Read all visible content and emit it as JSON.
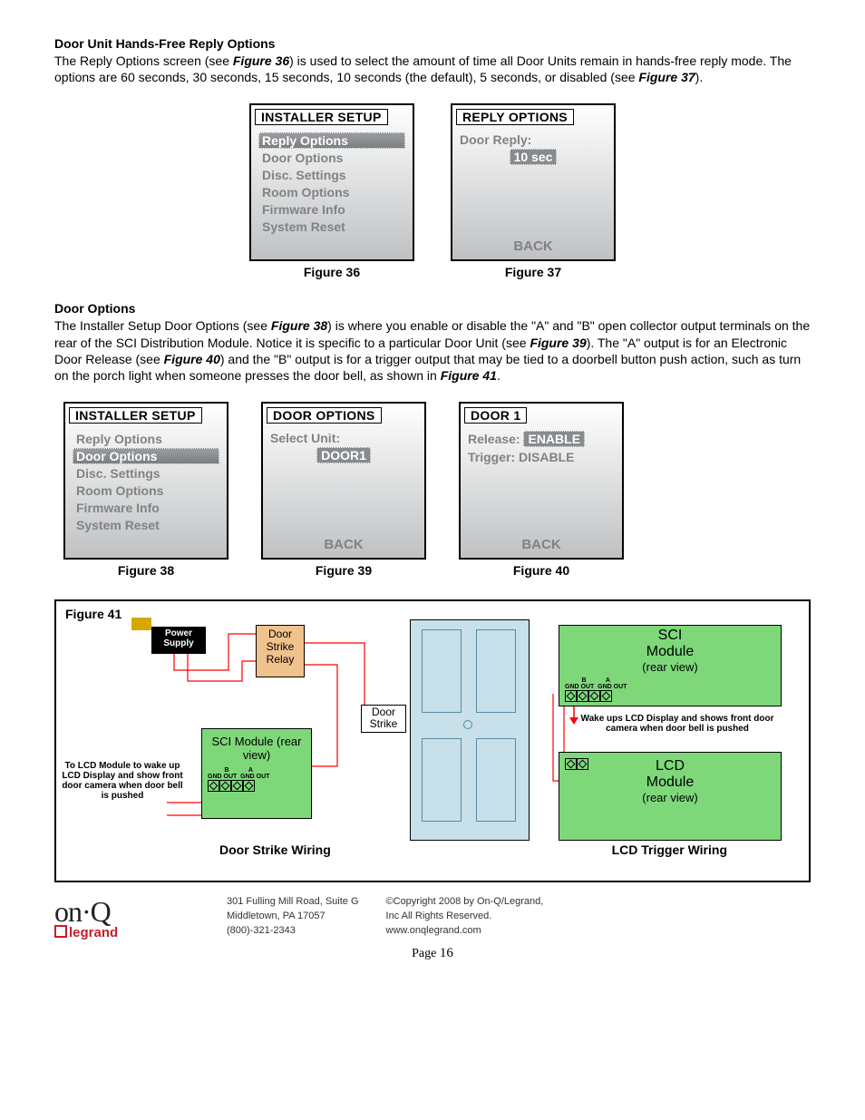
{
  "sections": {
    "reply": {
      "title": "Door Unit Hands-Free Reply Options",
      "text_parts": [
        "The Reply Options screen (see ",
        "Figure 36",
        ") is used to select the amount of time all Door Units remain in hands-free reply mode. The options are 60 seconds, 30 seconds, 15 seconds, 10 seconds (the default), 5 seconds, or disabled (see ",
        "Figure 37",
        ")."
      ]
    },
    "door_options": {
      "title": "Door Options",
      "text_parts": [
        "The Installer Setup Door Options (see ",
        "Figure 38",
        ") is where you enable or disable the \"A\" and \"B\" open collector output terminals on the rear of the SCI Distribution Module. Notice it is specific to a particular Door Unit (see ",
        "Figure 39",
        "). The \"A\" output is for an Electronic Door Release (see ",
        "Figure 40",
        ") and the \"B\" output is for a trigger output that may be tied to a doorbell button push action, such as turn on the porch light when someone presses the door bell, as shown in ",
        "Figure 41",
        "."
      ]
    }
  },
  "screens": {
    "fig36": {
      "title": "INSTALLER SETUP",
      "items": [
        "Reply Options",
        "Door Options",
        "Disc. Settings",
        "Room Options",
        "Firmware Info",
        "System Reset"
      ],
      "selected": 0,
      "caption": "Figure 36"
    },
    "fig37": {
      "title": "REPLY OPTIONS",
      "label": "Door Reply:",
      "value": "10 sec",
      "back": "BACK",
      "caption": "Figure 37"
    },
    "fig38": {
      "title": "INSTALLER SETUP",
      "items": [
        "Reply Options",
        "Door Options",
        "Disc. Settings",
        "Room Options",
        "Firmware Info",
        "System Reset"
      ],
      "selected": 1,
      "caption": "Figure 38"
    },
    "fig39": {
      "title": "DOOR OPTIONS",
      "label": "Select Unit:",
      "value": "DOOR1",
      "back": "BACK",
      "caption": "Figure 39"
    },
    "fig40": {
      "title": "DOOR 1",
      "line1_label": "Release:",
      "line1_val": "ENABLE",
      "line2_label": "Trigger:",
      "line2_val": "DISABLE",
      "back": "BACK",
      "caption": "Figure 40"
    }
  },
  "diagram": {
    "fig_label": "Figure 41",
    "psu": "Power\nSupply",
    "relay": "Door Strike Relay",
    "strike": "Door Strike",
    "sci_left": "SCI Module (rear view)",
    "sci_right_l1": "SCI",
    "sci_right_l2": "Module",
    "sci_right_l3": "(rear view)",
    "lcd_right_l1": "LCD",
    "lcd_right_l2": "Module",
    "lcd_right_l3": "(rear view)",
    "term_labels": "B           A\nGND OUT  GND OUT",
    "note_left": "To LCD Module to wake up LCD Display and show front door camera when door bell is pushed",
    "note_right": "Wake ups LCD Display and shows front door camera when door bell is pushed",
    "sub_left": "Door Strike Wiring",
    "sub_right": "LCD Trigger Wiring"
  },
  "footer": {
    "addr1": "301 Fulling Mill Road, Suite G",
    "addr2": "Middletown, PA   17057",
    "phone": "(800)-321-2343",
    "copy": "©Copyright 2008 by On-Q/Legrand,",
    "copy2": "Inc All Rights Reserved.",
    "url": "www.onqlegrand.com",
    "page": "Page 16",
    "logo_top": "on·Q",
    "logo_bot": "legrand"
  }
}
